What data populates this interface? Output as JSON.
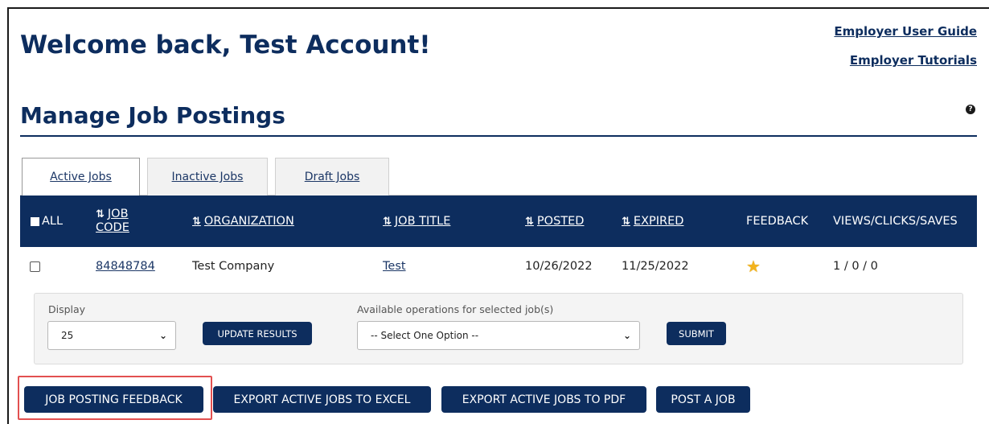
{
  "header": {
    "welcome": "Welcome back, Test Account!",
    "user_guide_link": "Employer User Guide",
    "tutorials_link": "Employer Tutorials"
  },
  "section": {
    "title": "Manage Job Postings",
    "help_icon": "question-circle-icon"
  },
  "tabs": [
    {
      "label": "Active Jobs",
      "active": true
    },
    {
      "label": "Inactive Jobs",
      "active": false
    },
    {
      "label": "Draft Jobs",
      "active": false
    }
  ],
  "table": {
    "headers": {
      "all": "ALL",
      "job_code_1": "JOB",
      "job_code_2": "CODE",
      "organization": "ORGANIZATION",
      "job_title": "JOB TITLE",
      "posted": "POSTED",
      "expired": "EXPIRED",
      "feedback": "FEEDBACK",
      "stats": "VIEWS/CLICKS/SAVES"
    },
    "sort_glyph": "⇅",
    "rows": [
      {
        "job_code": "84848784",
        "organization": "Test Company",
        "job_title": "Test",
        "posted": "10/26/2022",
        "expired": "11/25/2022",
        "feedback_icon": "star-icon",
        "stats": "1 / 0 / 0"
      }
    ]
  },
  "options": {
    "display_label": "Display",
    "display_value": "25",
    "update_button": "UPDATE RESULTS",
    "operations_label": "Available operations for selected job(s)",
    "operations_value": "-- Select One Option --",
    "submit_button": "SUBMIT"
  },
  "actions": {
    "feedback": "JOB POSTING FEEDBACK",
    "export_excel": "EXPORT ACTIVE JOBS TO EXCEL",
    "export_pdf": "EXPORT ACTIVE JOBS TO PDF",
    "post_job": "POST A JOB"
  },
  "colors": {
    "brand_navy": "#0d2d5e",
    "highlight_red": "#e25050",
    "star_gold": "#f3b31c"
  }
}
